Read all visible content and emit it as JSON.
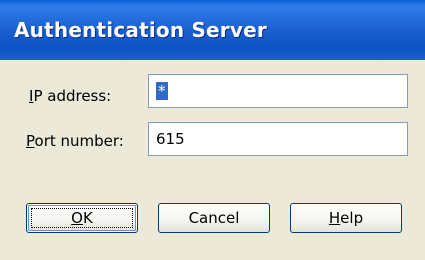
{
  "window": {
    "title": "Authentication Server"
  },
  "form": {
    "ip_label_prefix": "I",
    "ip_label_rest": "P address:",
    "ip_value": "*",
    "port_label_prefix": "P",
    "port_label_rest": "ort number:",
    "port_value": "615"
  },
  "buttons": {
    "ok_mnemonic": "O",
    "ok_rest": "K",
    "cancel": "Cancel",
    "help_mnemonic": "H",
    "help_rest": "elp"
  }
}
